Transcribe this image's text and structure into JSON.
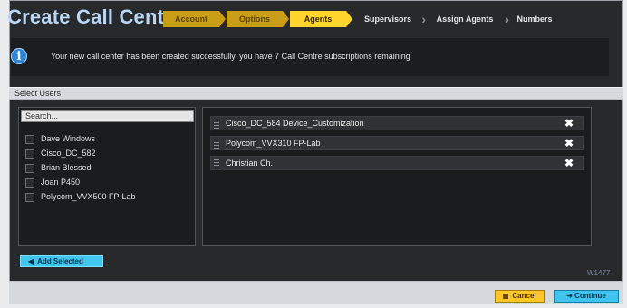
{
  "header": {
    "title": "Create Call Centre"
  },
  "wizard": {
    "steps": [
      {
        "label": "Account",
        "state": "done"
      },
      {
        "label": "Options",
        "state": "done"
      },
      {
        "label": "Agents",
        "state": "active"
      },
      {
        "label": "Supervisors",
        "state": "todo"
      },
      {
        "label": "Assign Agents",
        "state": "todo"
      },
      {
        "label": "Numbers",
        "state": "todo"
      }
    ]
  },
  "notice": {
    "icon": "info-icon",
    "text": "Your new call center has been created successfully, you have 7 Call Centre subscriptions remaining"
  },
  "section": {
    "title": "Select Users"
  },
  "search": {
    "placeholder": "Search..."
  },
  "available_users": [
    "Dave Windows",
    "Cisco_DC_582",
    "Brian Blessed",
    "Joan P450",
    "Polycom_VVX500 FP-Lab"
  ],
  "selected_agents": [
    "Cisco_DC_584 Device_Customization",
    "Polycom_VVX310 FP-Lab",
    "Christian Ch."
  ],
  "buttons": {
    "add_selected": "Add Selected",
    "cancel": "Cancel",
    "continue": "Continue"
  },
  "version": "W1477",
  "colors": {
    "title": "#b9d8f7",
    "step_done": "#c99d16",
    "step_active": "#ffd52e",
    "accent_blue": "#42c5ef",
    "cancel_yellow": "#ffc629"
  }
}
